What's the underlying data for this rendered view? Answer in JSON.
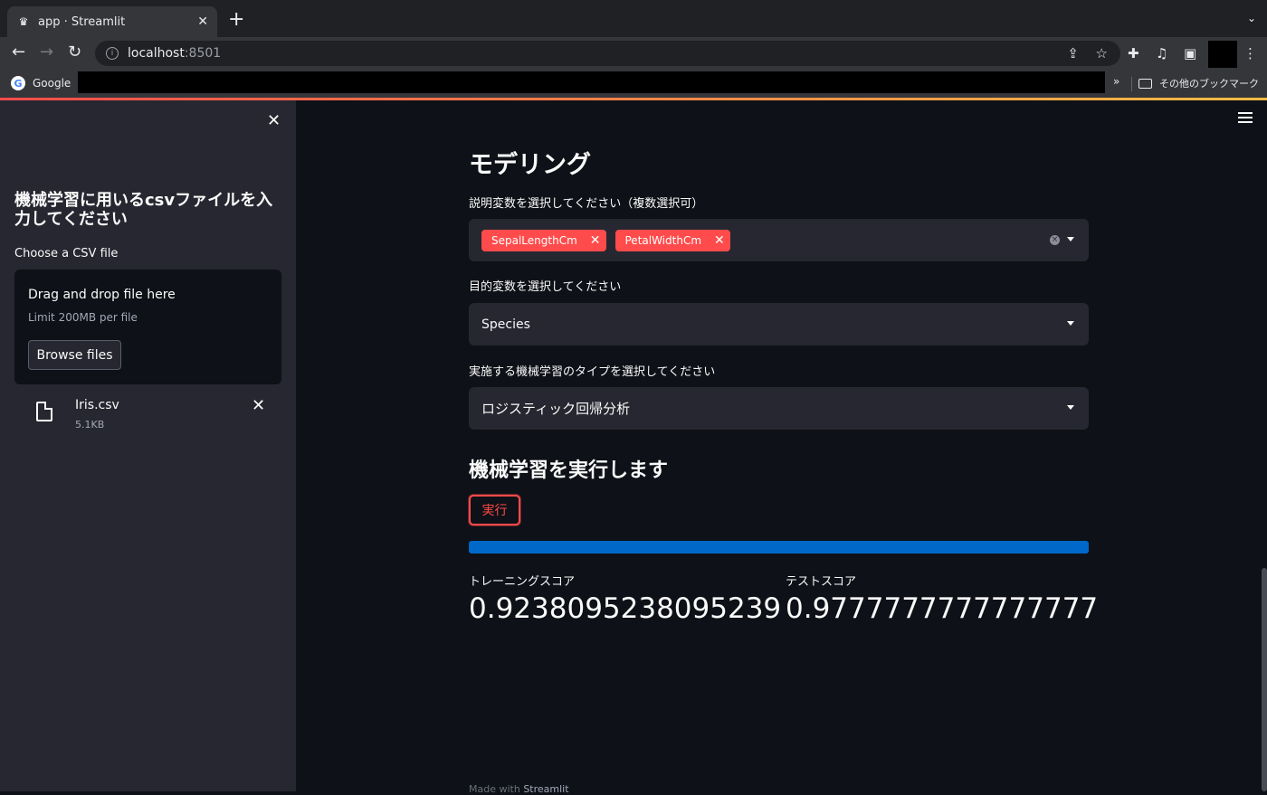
{
  "browser": {
    "tab_title": "app · Streamlit",
    "tab_close": "✕",
    "new_tab": "+",
    "tab_menu": "⌄",
    "url_host": "localhost",
    "url_port": ":8501",
    "bookmark_google": "Google",
    "bookmark_more": "»",
    "bookmark_other": "その他のブックマーク"
  },
  "sidebar": {
    "close": "✕",
    "title": "機械学習に用いるcsvファイルを入力してください",
    "uploader_label": "Choose a CSV file",
    "dropzone_main": "Drag and drop file here",
    "dropzone_limit": "Limit 200MB per file",
    "browse_label": "Browse files",
    "file": {
      "name": "Iris.csv",
      "size": "5.1KB",
      "remove": "✕"
    }
  },
  "main": {
    "modeling_header": "モデリング",
    "features_label": "説明変数を選択してください（複数選択可）",
    "features_selected": [
      "SepalLengthCm",
      "PetalWidthCm"
    ],
    "target_label": "目的変数を選択してください",
    "target_value": "Species",
    "type_label": "実施する機械学習のタイプを選択してください",
    "type_value": "ロジスティック回帰分析",
    "run_header": "機械学習を実行します",
    "run_button": "実行",
    "progress": 1.0,
    "train_label": "トレーニングスコア",
    "train_value": "0.9238095238095239",
    "test_label": "テストスコア",
    "test_value": "0.9777777777777777",
    "footer_prefix": "Made with ",
    "footer_brand": "Streamlit"
  },
  "colors": {
    "accent": "#ff4b4b",
    "progress": "#0068c9",
    "background": "#0e1117",
    "sidebar": "#262730"
  }
}
